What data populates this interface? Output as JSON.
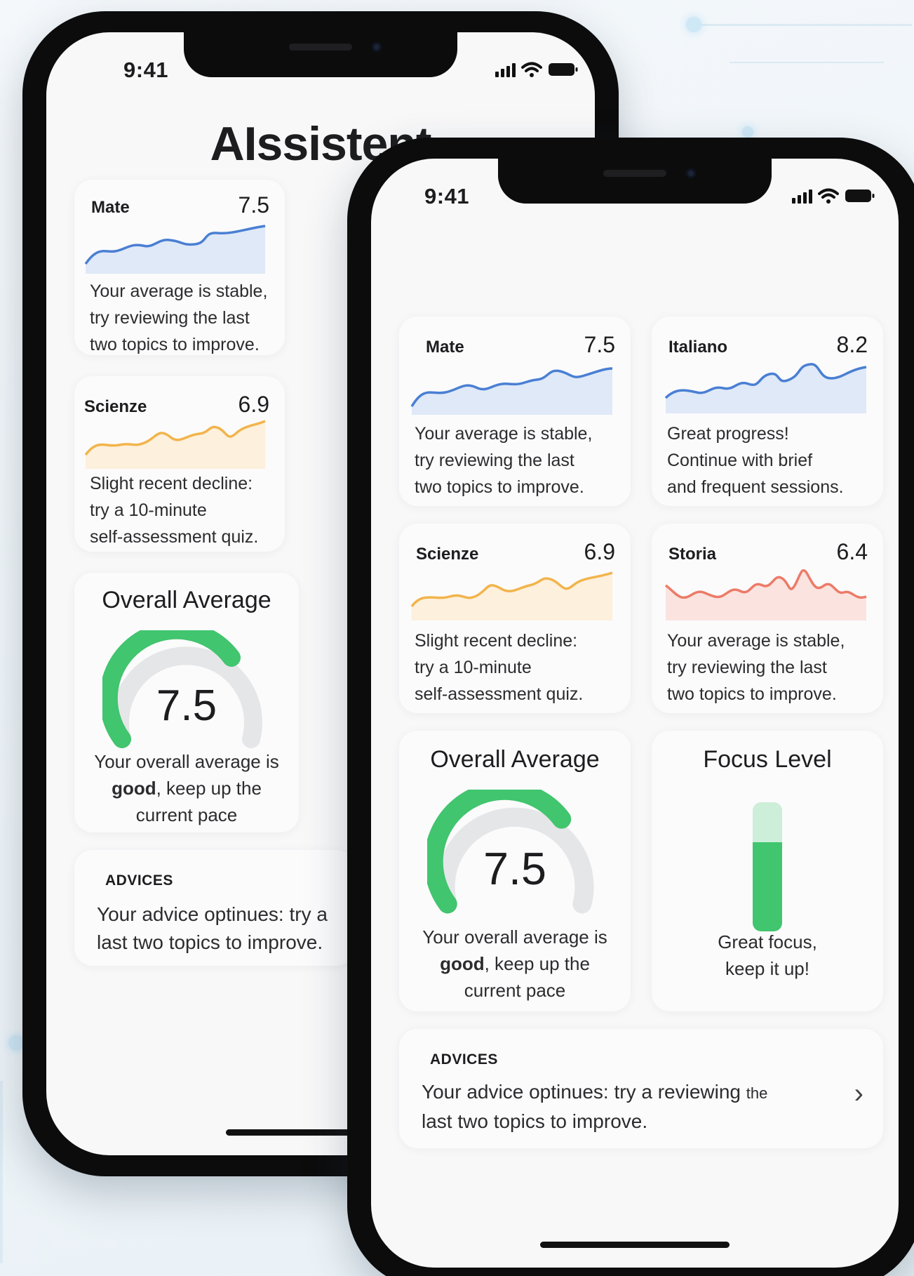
{
  "colors": {
    "blue": "#4a7fd3",
    "orange": "#f2b44c",
    "red": "#ec7b68",
    "green": "#41c56e",
    "gauge_track": "#e5e6e8"
  },
  "back_phone": {
    "status_time": "9:41",
    "title": "AIssistent",
    "cards": [
      {
        "subject": "Mate",
        "value": "7.5",
        "message": [
          "Your average is stable,",
          "try reviewing the last",
          "two topics to improve."
        ],
        "color": "blue"
      },
      {
        "subject": "Scienze",
        "value": "6.9",
        "message": [
          "Slight recent decline:",
          "try a 10-minute",
          "self-assessment quiz."
        ],
        "color": "orange"
      }
    ],
    "overall": {
      "title": "Overall Average",
      "value": "7.5",
      "fill_fraction": 0.55,
      "line1": "Your overall average is",
      "bold_word": "good",
      "line2_rest": ", keep up the",
      "line3": "current pace"
    },
    "advices": {
      "heading": "ADVICES",
      "line1": "Your advice optinues: try a",
      "line2": "last two topics to improve."
    }
  },
  "front_phone": {
    "status_time": "9:41",
    "cards": [
      {
        "subject": "Mate",
        "value": "7.5",
        "message": [
          "Your average is stable,",
          "try reviewing the last",
          "two topics to improve."
        ],
        "color": "blue"
      },
      {
        "subject": "Italiano",
        "value": "8.2",
        "message": [
          "Great progress!",
          "Continue with brief",
          "and frequent sessions."
        ],
        "color": "blue"
      },
      {
        "subject": "Scienze",
        "value": "6.9",
        "message": [
          "Slight recent decline:",
          "try a 10-minute",
          "self-assessment quiz."
        ],
        "color": "orange"
      },
      {
        "subject": "Storia",
        "value": "6.4",
        "message": [
          "Your average is stable,",
          "try reviewing the last",
          "two topics to improve."
        ],
        "color": "red"
      }
    ],
    "overall": {
      "title": "Overall Average",
      "value": "7.5",
      "fill_fraction": 0.55,
      "line1": "Your overall average is",
      "bold_word": "good",
      "line2_rest": ", keep up the",
      "line3": "current pace"
    },
    "focus": {
      "title": "Focus Level",
      "level_fraction": 0.69,
      "line1": "Great focus,",
      "line2": "keep it up!"
    },
    "advices": {
      "heading": "ADVICES",
      "line1": "Your advice optinues: try a reviewing ",
      "line1_small": "the",
      "line2": "last two topics to improve.",
      "chevron": "›"
    }
  }
}
